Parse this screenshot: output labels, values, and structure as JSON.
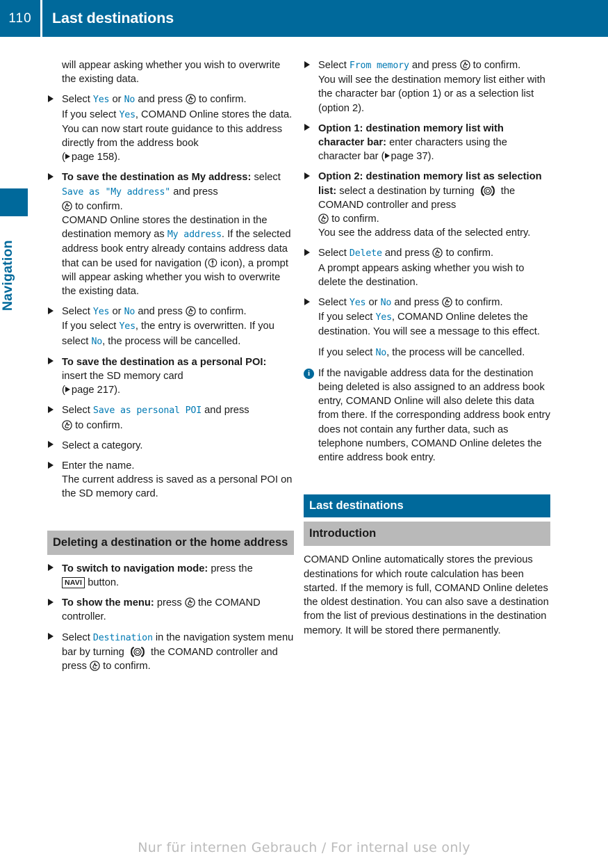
{
  "header": {
    "page_number": "110",
    "title": "Last destinations"
  },
  "side_tab": {
    "label": "Navigation"
  },
  "icons": {
    "press_controller": "press-comand-controller-icon",
    "turn_controller": "turn-comand-controller-icon",
    "navigation_marker": "navigation-compass-icon",
    "page_reference": "page-reference-arrow-icon",
    "info": "info-icon",
    "bullet": "triangle-bullet-icon"
  },
  "colors": {
    "accent_blue": "#00699b",
    "mono_blue": "#0079b3",
    "grey_heading": "#b9b9b9",
    "text": "#1a1a1a"
  },
  "left_column": {
    "p1": "will appear asking whether you wish to overwrite the existing data.",
    "b1": {
      "lead": "Select",
      "term_yes": "Yes",
      "mid_or": "or",
      "term_no": "No",
      "tail": "and press",
      "confirm": "to confirm.",
      "sub1_a": "If you select",
      "sub1_yes": "Yes",
      "sub1_b": ", COMAND Online stores the data.",
      "sub2": "You can now start route guidance to this address directly from the address book",
      "sub2_ref_open": "(",
      "sub2_ref": "page 158).",
      "sub2_page": "158"
    },
    "b2": {
      "bold": "To save the destination as My address:",
      "lead": "select",
      "term": "Save as \"My address\"",
      "tail": "and press",
      "confirm": "to confirm.",
      "sub_a": "COMAND Online stores the destination in the destination memory as",
      "sub_term": "My address",
      "sub_b": ". If the selected address book entry already contains address data that can be used for navigation (",
      "sub_c": "icon), a prompt will appear asking whether you wish to overwrite the existing data."
    },
    "b3": {
      "lead": "Select",
      "term_yes": "Yes",
      "mid_or": "or",
      "term_no": "No",
      "tail": "and press",
      "confirm": "to confirm.",
      "sub_a": "If you select",
      "sub_yes": "Yes",
      "sub_b": ", the entry is overwritten. If you select",
      "sub_no": "No",
      "sub_c": ", the process will be cancelled."
    },
    "b4": {
      "bold": "To save the destination as a personal POI:",
      "tail": "insert the SD memory card",
      "ref": "page 217).",
      "ref_open": "("
    },
    "b5": {
      "lead": "Select",
      "term": "Save as personal POI",
      "tail": "and press",
      "confirm": "to confirm."
    },
    "b6": {
      "text": "Select a category."
    },
    "b7": {
      "text": "Enter the name.",
      "sub": "The current address is saved as a personal POI on the SD memory card."
    },
    "heading_grey": "Deleting a destination or the home address",
    "b8": {
      "bold": "To switch to navigation mode:",
      "tail": "press the",
      "button": "NAVI",
      "after": "button."
    },
    "b9": {
      "bold": "To show the menu:",
      "tail": "press",
      "after": "the COMAND controller."
    },
    "b10": {
      "lead": "Select",
      "term": "Destination",
      "mid": "in the navigation system menu bar by turning",
      "after": "the COMAND controller and press",
      "confirm": "to confirm."
    }
  },
  "right_column": {
    "b1": {
      "lead": "Select",
      "term": "From memory",
      "tail": "and press",
      "confirm": "to confirm.",
      "sub": "You will see the destination memory list either with the character bar (option 1) or as a selection list (option 2)."
    },
    "b2": {
      "bold": "Option 1: destination memory list with character bar:",
      "tail": "enter characters using the character bar (",
      "ref": "page 37)."
    },
    "b3": {
      "bold": "Option 2: destination memory list as selection list:",
      "tail": "select a destination by turning",
      "after": "the COMAND controller and press",
      "confirm": "to confirm.",
      "sub": "You see the address data of the selected entry."
    },
    "b4": {
      "lead": "Select",
      "term": "Delete",
      "tail": "and press",
      "confirm": "to confirm.",
      "sub": "A prompt appears asking whether you wish to delete the destination."
    },
    "b5": {
      "lead": "Select",
      "term_yes": "Yes",
      "mid_or": "or",
      "term_no": "No",
      "tail": "and press",
      "confirm": "to confirm.",
      "sub_a": "If you select",
      "sub_yes": "Yes",
      "sub_b": ", COMAND Online deletes the destination. You will see a message to this effect.",
      "sub_c": "If you select",
      "sub_no": "No",
      "sub_d": ", the process will be cancelled."
    },
    "note": "If the navigable address data for the destination being deleted is also assigned to an address book entry, COMAND Online will also delete this data from there. If the corresponding address book entry does not contain any further data, such as telephone numbers, COMAND Online deletes the entire address book entry.",
    "heading_blue": "Last destinations",
    "heading_grey": "Introduction",
    "intro": "COMAND Online automatically stores the previous destinations for which route calculation has been started. If the memory is full, COMAND Online deletes the oldest destination. You can also save a destination from the list of previous destinations in the destination memory. It will be stored there permanently."
  },
  "footer": {
    "watermark": "Nur für internen Gebrauch / For internal use only"
  }
}
